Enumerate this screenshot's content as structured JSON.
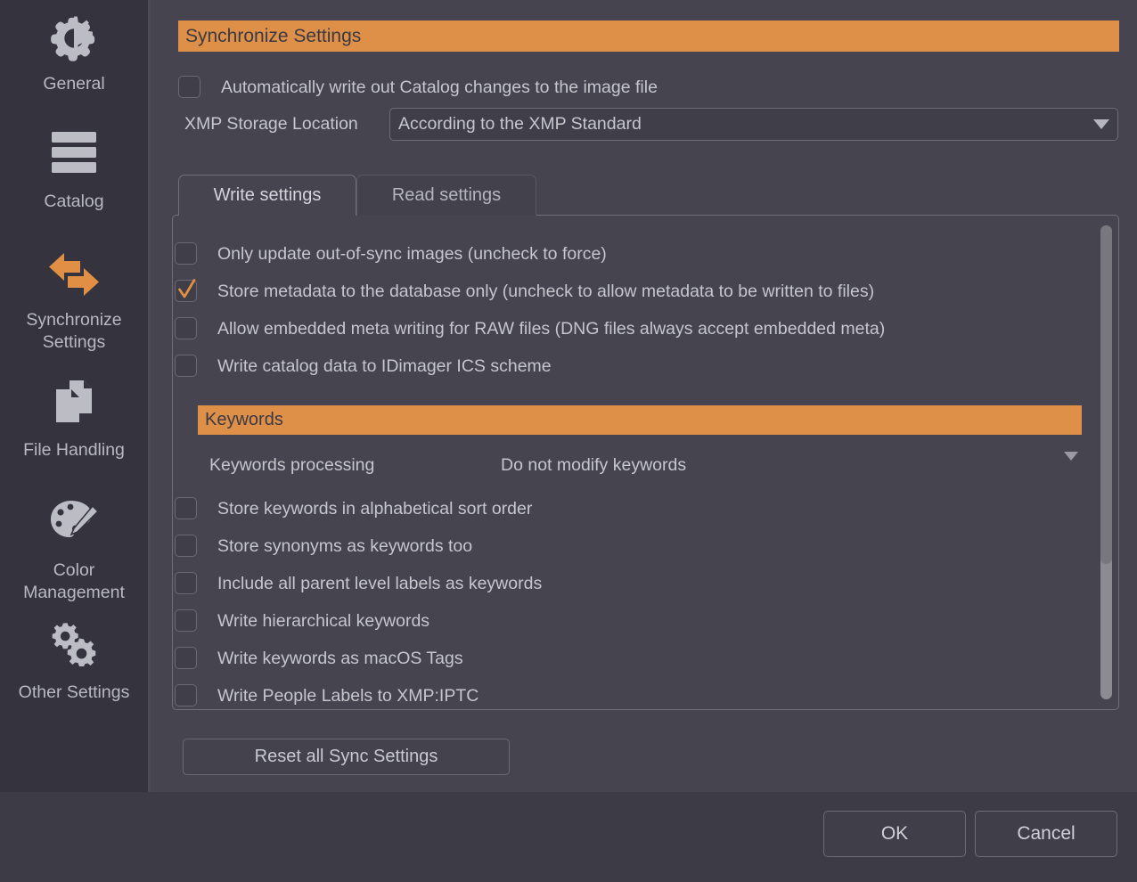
{
  "colors": {
    "accent": "#de9049",
    "panel_bg": "#45444f",
    "sidebar_bg": "#35343e",
    "footer_bg": "#3c3b46",
    "text": "#c6c6cd",
    "border": "#6d6c78",
    "checkmark": "#e08f44"
  },
  "sidebar": {
    "items": [
      {
        "label": "General",
        "icon": "gear-icon"
      },
      {
        "label": "Catalog",
        "icon": "stack-lines-icon"
      },
      {
        "label": "Synchronize\nSettings",
        "icon": "sync-arrows-icon"
      },
      {
        "label": "File Handling",
        "icon": "documents-icon"
      },
      {
        "label": "Color\nManagement",
        "icon": "palette-icon"
      },
      {
        "label": "Other Settings",
        "icon": "gears-icon"
      }
    ]
  },
  "main": {
    "section_title": "Synchronize Settings",
    "auto_write": {
      "label": "Automatically write out Catalog changes to the image file",
      "checked": false
    },
    "xmp": {
      "label": "XMP Storage Location",
      "value": "According to the XMP Standard",
      "arrow_icon": "chevron-down-icon"
    },
    "tabs": [
      {
        "label": "Write settings",
        "active": true
      },
      {
        "label": "Read settings",
        "active": false
      }
    ],
    "write_settings": {
      "options": [
        {
          "label": "Only update out-of-sync images (uncheck to force)",
          "checked": false
        },
        {
          "label": "Store metadata to the database only (uncheck to allow metadata to be written to files)",
          "checked": true
        },
        {
          "label": "Allow embedded meta writing for RAW files (DNG files always accept embedded meta)",
          "checked": false
        },
        {
          "label": "Write catalog data to IDimager ICS scheme",
          "checked": false
        }
      ],
      "keywords_header": "Keywords",
      "keywords_processing": {
        "label": "Keywords processing",
        "value": "Do not modify keywords",
        "arrow_icon": "chevron-down-icon"
      },
      "keyword_options": [
        {
          "label": "Store keywords in alphabetical sort order",
          "checked": false
        },
        {
          "label": "Store synonyms as keywords too",
          "checked": false
        },
        {
          "label": "Include all parent level labels as keywords",
          "checked": false
        },
        {
          "label": "Write hierarchical keywords",
          "checked": false
        },
        {
          "label": "Write keywords as macOS Tags",
          "checked": false
        },
        {
          "label": "Write People Labels to XMP:IPTC",
          "checked": false
        }
      ]
    },
    "reset_button": "Reset all Sync Settings"
  },
  "footer": {
    "ok_label": "OK",
    "cancel_label": "Cancel"
  }
}
